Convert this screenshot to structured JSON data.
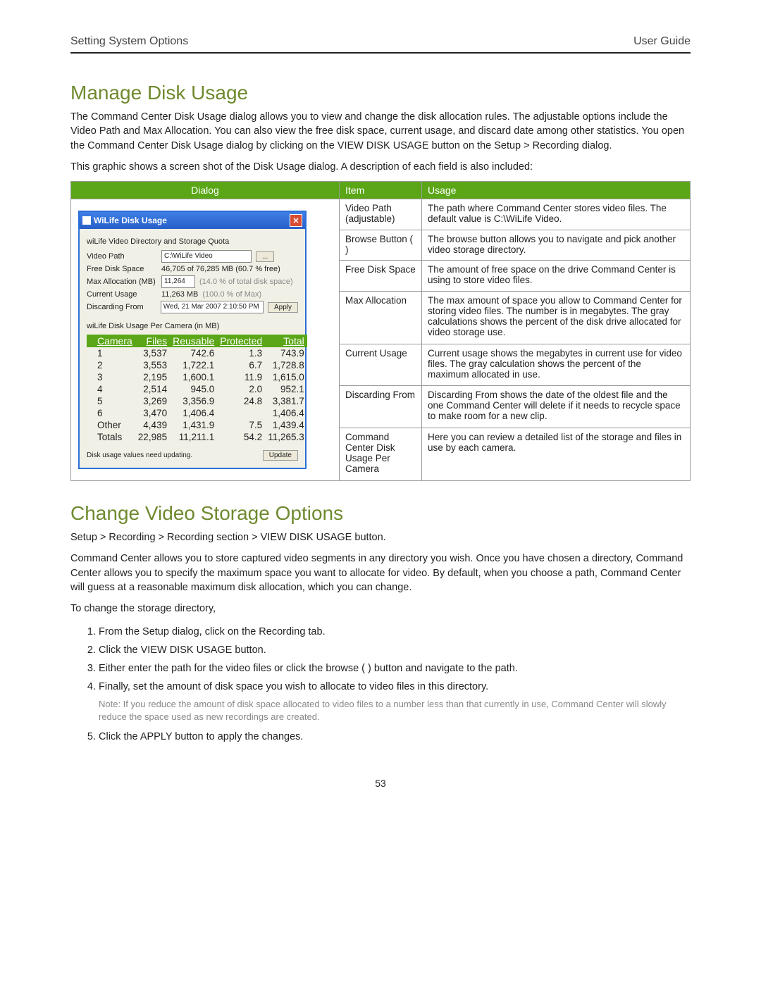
{
  "header": {
    "left": "Setting System Options",
    "right": "User Guide"
  },
  "h1": "Manage Disk Usage",
  "p1": "The Command Center Disk Usage dialog allows you to view and change the disk allocation rules. The adjustable options include the Video Path and Max Allocation. You can also view the free disk space, current usage, and discard date among other statistics. You open the Command Center Disk Usage dialog by clicking on the VIEW DISK USAGE button on the Setup > Recording dialog.",
  "p2": "This graphic shows a screen shot of the Disk Usage dialog. A description of each field is also included:",
  "columns": {
    "c1": "Dialog",
    "c2": "Item",
    "c3": "Usage"
  },
  "rows": [
    {
      "item": "Video Path (adjustable)",
      "usage": "The path where Command Center stores video files. The default value is C:\\WiLife Video."
    },
    {
      "item": "Browse Button (   )",
      "usage": "The browse button allows you to navigate and pick another video storage directory."
    },
    {
      "item": "Free Disk Space",
      "usage": "The amount of free space on the drive Command Center is using to store video files."
    },
    {
      "item": "Max Allocation",
      "usage": "The max amount of space you allow to Command Center for storing video files. The number is in megabytes. The gray calculations shows the percent of the disk drive allocated for video storage use."
    },
    {
      "item": "Current Usage",
      "usage": "Current usage shows the megabytes in current use for video files. The gray calculation shows the percent of the maximum allocated in use."
    },
    {
      "item": "Discarding From",
      "usage": "Discarding From shows the date of the oldest file and the one Command Center will delete if it needs to recycle space to make room for a new clip."
    },
    {
      "item": "Command Center Disk Usage Per Camera",
      "usage": "Here you can review a detailed list of the storage and files in use by each camera."
    }
  ],
  "dialog": {
    "title": "WiLife Disk Usage",
    "section1": "wiLife Video Directory and Storage Quota",
    "video_path_label": "Video Path",
    "video_path_value": "C:\\WiLife Video",
    "free_label": "Free Disk Space",
    "free_value": "46,705 of 76,285 MB (60.7 % free)",
    "max_label": "Max Allocation (MB)",
    "max_value": "11,264",
    "max_extra": "(14.0 % of total disk space)",
    "cur_label": "Current Usage",
    "cur_value": "11,263 MB",
    "cur_extra": "(100.0 % of Max)",
    "disc_label": "Discarding From",
    "disc_value": "Wed, 21 Mar 2007 2:10:50 PM",
    "apply": "Apply",
    "section2": "wiLife Disk Usage Per Camera (in MB)",
    "headers": [
      "Camera",
      "Files",
      "Reusable",
      "Protected",
      "Total"
    ],
    "datarows": [
      [
        "1",
        "3,537",
        "742.6",
        "1.3",
        "743.9"
      ],
      [
        "2",
        "3,553",
        "1,722.1",
        "6.7",
        "1,728.8"
      ],
      [
        "3",
        "2,195",
        "1,600.1",
        "11.9",
        "1,615.0"
      ],
      [
        "4",
        "2,514",
        "945.0",
        "2.0",
        "952.1"
      ],
      [
        "5",
        "3,269",
        "3,356.9",
        "24.8",
        "3,381.7"
      ],
      [
        "6",
        "3,470",
        "1,406.4",
        "",
        "1,406.4"
      ],
      [
        "Other",
        "4,439",
        "1,431.9",
        "7.5",
        "1,439.4"
      ],
      [
        "Totals",
        "22,985",
        "11,211.1",
        "54.2",
        "11,265.3"
      ]
    ],
    "update_msg": "Disk usage values need updating.",
    "update_btn": "Update"
  },
  "h2": "Change Video Storage Options",
  "nav": "Setup > Recording > Recording section > VIEW DISK USAGE button.",
  "p3": "Command Center allows you to store captured video segments in any directory you wish. Once you have chosen a directory, Command Center allows you to specify the maximum space you want to allocate for video. By default, when you choose a path, Command Center will guess at a reasonable maximum disk allocation, which you can change.",
  "p4": "To change the storage directory,",
  "steps": [
    "From the Setup dialog, click on the Recording tab.",
    "Click the VIEW DISK USAGE button.",
    "Either enter the path for the video files or click the browse (   ) button and navigate to the path.",
    "Finally, set the amount of disk space you wish to allocate to video files in this directory."
  ],
  "step4note": "Note: If you reduce the amount of disk space allocated to video files to a number less than that currently in use, Command Center will slowly reduce the space used as new recordings are created.",
  "step5": "Click the APPLY button to apply the changes.",
  "pagenum": "53"
}
